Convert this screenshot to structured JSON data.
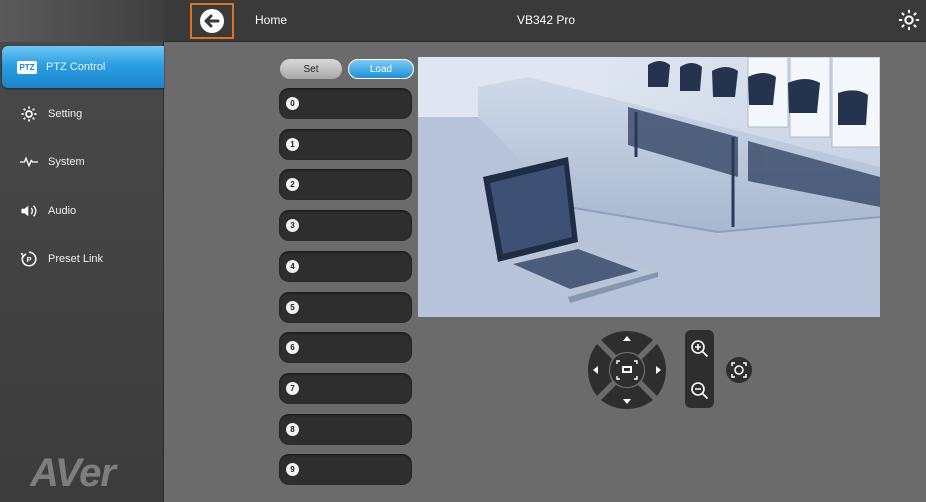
{
  "header": {
    "home_label": "Home",
    "title": "VB342 Pro"
  },
  "sidebar": {
    "items": [
      {
        "label": "PTZ Control",
        "icon": "ptz-icon",
        "badge": "PTZ",
        "active": true
      },
      {
        "label": "Setting",
        "icon": "gear-icon"
      },
      {
        "label": "System",
        "icon": "pulse-icon"
      },
      {
        "label": "Audio",
        "icon": "speaker-icon"
      },
      {
        "label": "Preset Link",
        "icon": "preset-link-icon"
      }
    ],
    "logo": "AVer"
  },
  "preset_controls": {
    "set_label": "Set",
    "load_label": "Load",
    "active_mode": "Load"
  },
  "presets": [
    "0",
    "1",
    "2",
    "3",
    "4",
    "5",
    "6",
    "7",
    "8",
    "9"
  ],
  "colors": {
    "accent": "#1a85cc",
    "highlight": "#e2731e",
    "background": "#6b6b6b",
    "panel": "#2e2e2e"
  }
}
